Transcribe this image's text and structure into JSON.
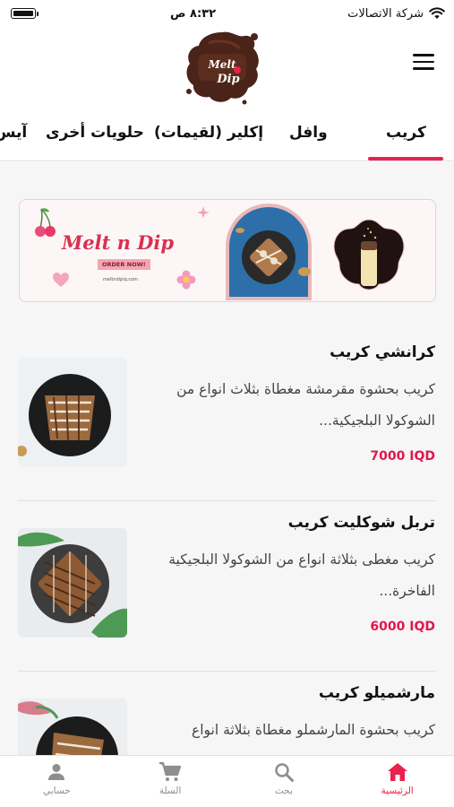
{
  "status_bar": {
    "carrier": "شركة الاتصالات",
    "time": "٨:٣٢ ص",
    "wifi_icon": "wifi-icon",
    "battery_icon": "battery-icon"
  },
  "header": {
    "menu_icon": "hamburger-menu-icon",
    "logo_alt": "Melt n Dip"
  },
  "tabs": [
    {
      "label": "كريب",
      "active": true
    },
    {
      "label": "وافل",
      "active": false
    },
    {
      "label": "إكلير (لقيمات)",
      "active": false
    },
    {
      "label": "حلويات أخرى",
      "active": false
    },
    {
      "label": "آيس",
      "active": false
    }
  ],
  "banner": {
    "title": "Melt n Dip",
    "cta": "ORDER NOW!",
    "url": "meltndipiq.com"
  },
  "products": [
    {
      "name": "كرانشي كريب",
      "description": "كريب بحشوة مقرمشة مغطاة بثلاث انواع من الشوكولا البلجيكية...",
      "price": "7000 IQD"
    },
    {
      "name": "تربل شوكليت كريب",
      "description": "كريب مغطى بثلاثة انواع من الشوكولا البلجيكية الفاخرة...",
      "price": "6000 IQD"
    },
    {
      "name": "مارشميلو كريب",
      "description": "كريب بحشوة المارشملو مغطاة بثلاثة انواع",
      "price": ""
    }
  ],
  "bottom_nav": [
    {
      "label": "حسابي",
      "icon": "person-icon",
      "active": false
    },
    {
      "label": "السلة",
      "icon": "cart-icon",
      "active": false
    },
    {
      "label": "بحث",
      "icon": "search-icon",
      "active": false
    },
    {
      "label": "الرئيسية",
      "icon": "home-icon",
      "active": true
    }
  ],
  "colors": {
    "accent": "#e8214f",
    "price": "#e0184d",
    "inactive": "#8e8e8e",
    "background": "#f6f6f6"
  }
}
